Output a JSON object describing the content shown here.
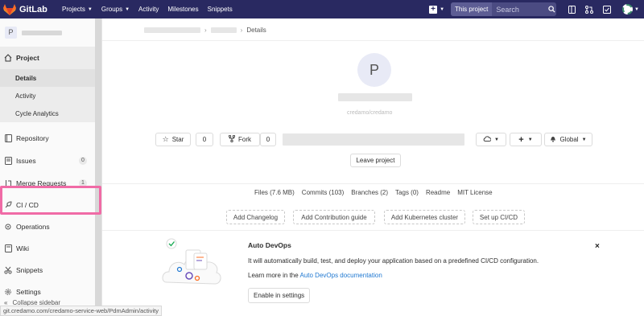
{
  "navbar": {
    "brand": "GitLab",
    "links": [
      "Projects",
      "Groups",
      "Activity",
      "Milestones",
      "Snippets"
    ],
    "search_scope": "This project",
    "search_placeholder": "Search"
  },
  "sidebar": {
    "project_initial": "P",
    "project_section": "Project",
    "project_subitems": [
      "Details",
      "Activity",
      "Cycle Analytics"
    ],
    "items": {
      "repository": "Repository",
      "issues": "Issues",
      "issues_count": "0",
      "merge_requests": "Merge Requests",
      "merge_requests_count": "1",
      "ci_cd": "CI / CD",
      "operations": "Operations",
      "wiki": "Wiki",
      "snippets": "Snippets",
      "settings": "Settings"
    },
    "collapse": "Collapse sidebar"
  },
  "breadcrumb": {
    "current": "Details"
  },
  "project": {
    "initial": "P",
    "subtitle": "credamo/credamo",
    "star_label": "Star",
    "star_count": "0",
    "fork_label": "Fork",
    "fork_count": "0",
    "notify_label": "Global",
    "leave_label": "Leave project"
  },
  "stats": {
    "files": "Files (7.6 MB)",
    "commits": "Commits (103)",
    "branches": "Branches (2)",
    "tags": "Tags (0)",
    "readme": "Readme",
    "license": "MIT License"
  },
  "actions": {
    "changelog": "Add Changelog",
    "contribution": "Add Contribution guide",
    "kubernetes": "Add Kubernetes cluster",
    "cicd": "Set up CI/CD"
  },
  "devops": {
    "title": "Auto DevOps",
    "description": "It will automatically build, test, and deploy your application based on a predefined CI/CD configuration.",
    "learn_prefix": "Learn more in the",
    "learn_link": "Auto DevOps documentation",
    "button": "Enable in settings",
    "close": "×"
  },
  "statusbar": {
    "url": "git.credamo.com/credamo-service-web/PdmAdmin/activity"
  },
  "colors": {
    "navbar_bg": "#292961",
    "highlight_box": "#f06ba6",
    "link": "#1f78d1"
  },
  "icons": [
    "gitlab-logo-icon",
    "plus-icon",
    "search-icon",
    "sidebar-toggle-icon",
    "merge-request-icon",
    "todo-icon",
    "star-icon",
    "fork-icon",
    "bell-icon",
    "close-icon"
  ]
}
